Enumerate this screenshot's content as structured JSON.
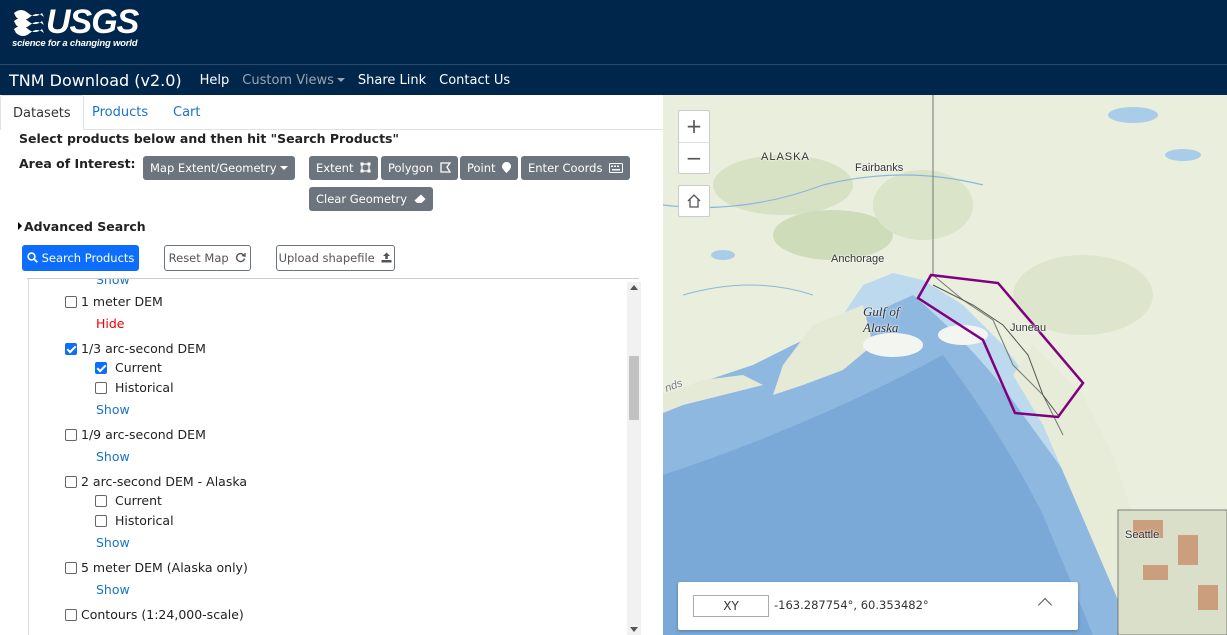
{
  "logo": {
    "wordmark": "USGS",
    "tagline": "science for a changing world"
  },
  "nav": {
    "brand": "TNM Download (v2.0)",
    "items": [
      {
        "label": "Help"
      },
      {
        "label": "Custom Views"
      },
      {
        "label": "Share Link"
      },
      {
        "label": "Contact Us"
      }
    ]
  },
  "tabs": [
    "Datasets",
    "Products",
    "Cart"
  ],
  "instructions": "Select products below and then hit \"Search Products\"",
  "aoi": {
    "label": "Area of Interest:",
    "dropdown": "Map Extent/Geometry",
    "buttons": [
      "Extent",
      "Polygon",
      "Point",
      "Enter Coords"
    ],
    "clear": "Clear Geometry"
  },
  "advanced_search": "Advanced Search",
  "actions": {
    "search": "Search Products",
    "reset": "Reset Map",
    "upload": "Upload shapefile"
  },
  "list": {
    "show": "Show",
    "hide": "Hide",
    "current": "Current",
    "historical": "Historical",
    "items": [
      {
        "label": "1 meter DEM",
        "checked": false
      },
      {
        "label": "1/3 arc-second DEM",
        "checked": true
      },
      {
        "label": "1/9 arc-second DEM",
        "checked": false
      },
      {
        "label": "2 arc-second DEM - Alaska",
        "checked": false
      },
      {
        "label": "5 meter DEM (Alaska only)",
        "checked": false
      },
      {
        "label": "Contours (1:24,000-scale)",
        "checked": false
      }
    ]
  },
  "map": {
    "labels": {
      "alaska": "ALASKA",
      "fairbanks": "Fairbanks",
      "anchorage": "Anchorage",
      "gulf1": "Gulf of",
      "gulf2": "Alaska",
      "juneau": "Juneau",
      "seattle": "Seattle",
      "partial": "nds"
    },
    "coord_mode": "XY",
    "coord_value": "-163.287754°, 60.353482°",
    "polygon_color": "#800080"
  }
}
